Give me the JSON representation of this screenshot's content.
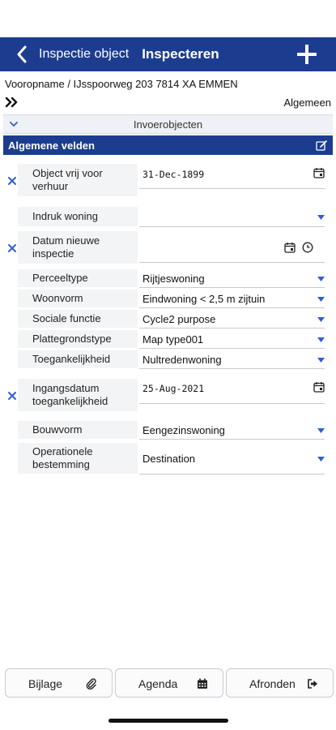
{
  "nav": {
    "back_label": "Inspectie object",
    "title": "Inspecteren"
  },
  "address": "Vooropname / IJsspoorweg 203  7814 XA EMMEN",
  "section_label": "Algemeen",
  "invoer_label": "Invoerobjecten",
  "band_title": "Algemene velden",
  "fields": [
    {
      "label": "Object vrij voor verhuur",
      "value": "31-Dec-1899",
      "type": "date",
      "clearable": true
    },
    {
      "label": "Indruk woning",
      "value": "",
      "type": "select",
      "clearable": false
    },
    {
      "label": "Datum nieuwe inspectie",
      "value": "",
      "type": "datetime",
      "clearable": true
    },
    {
      "label": "Perceeltype",
      "value": "Rijtjeswoning",
      "type": "select",
      "clearable": false
    },
    {
      "label": "Woonvorm",
      "value": "Eindwoning < 2,5 m zijtuin",
      "type": "select",
      "clearable": false
    },
    {
      "label": "Sociale functie",
      "value": "Cycle2 purpose",
      "type": "select",
      "clearable": false
    },
    {
      "label": "Plattegrondstype",
      "value": "Map type001",
      "type": "select",
      "clearable": false
    },
    {
      "label": "Toegankelijkheid",
      "value": "Nultredenwoning",
      "type": "select",
      "clearable": false
    },
    {
      "label": "Ingangsdatum toegankelijkheid",
      "value": "25-Aug-2021",
      "type": "date",
      "clearable": true
    },
    {
      "label": "Bouwvorm",
      "value": "Eengezinswoning",
      "type": "select",
      "clearable": false
    },
    {
      "label": "Operationele bestemming",
      "value": "Destination",
      "type": "select",
      "clearable": false
    }
  ],
  "bottom": {
    "bijlage": "Bijlage",
    "agenda": "Agenda",
    "afronden": "Afronden"
  },
  "colors": {
    "brand": "#1c3d8f",
    "caret": "#2f5fd0"
  }
}
